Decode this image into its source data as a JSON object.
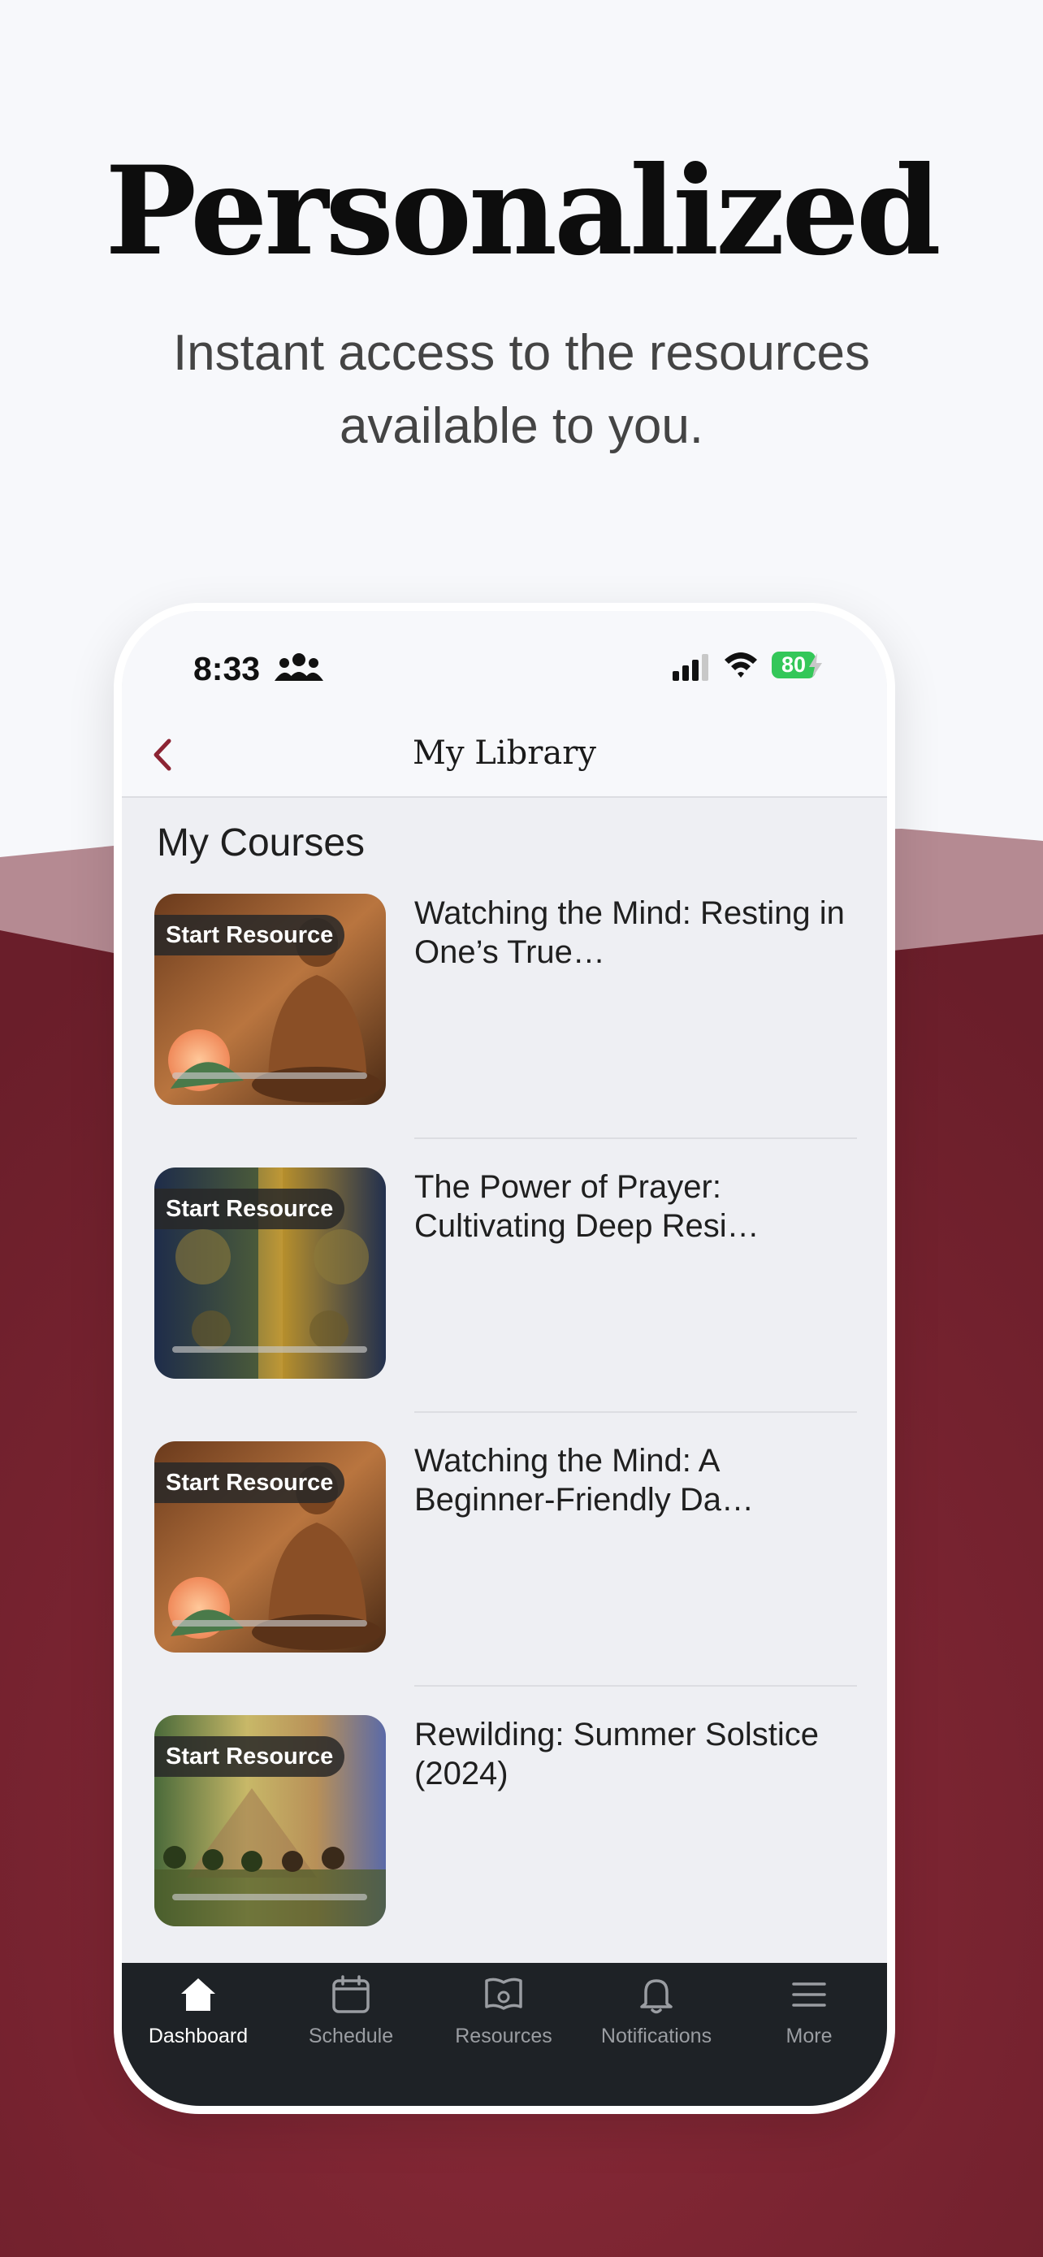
{
  "colors": {
    "accent": "#8c2433",
    "background_wave": "#762030",
    "tabbar_bg": "#1e2226",
    "battery": "#34c759"
  },
  "headline": "Personalized",
  "subline": "Instant access to the resources available to you.",
  "status": {
    "time": "8:33",
    "battery": "80"
  },
  "nav": {
    "title": "My Library",
    "back_icon": "chevron-left-icon"
  },
  "section_title": "My Courses",
  "courses": [
    {
      "badge": "Start Resource",
      "title": "Watching the Mind: Resting in One’s True…",
      "image": "buddha-lotus"
    },
    {
      "badge": "Start Resource",
      "title": "The Power of Prayer: Cultivating Deep Resi…",
      "image": "ornate-statue"
    },
    {
      "badge": "Start Resource",
      "title": "Watching the Mind: A Beginner-Friendly Da…",
      "image": "buddha-lotus"
    },
    {
      "badge": "Start Resource",
      "title": "Rewilding: Summer Solstice (2024)",
      "image": "meditating-group"
    }
  ],
  "tabs": [
    {
      "label": "Dashboard",
      "icon": "home-icon",
      "active": true
    },
    {
      "label": "Schedule",
      "icon": "calendar-icon",
      "active": false
    },
    {
      "label": "Resources",
      "icon": "book-icon",
      "active": false
    },
    {
      "label": "Notifications",
      "icon": "bell-icon",
      "active": false
    },
    {
      "label": "More",
      "icon": "menu-icon",
      "active": false
    }
  ]
}
